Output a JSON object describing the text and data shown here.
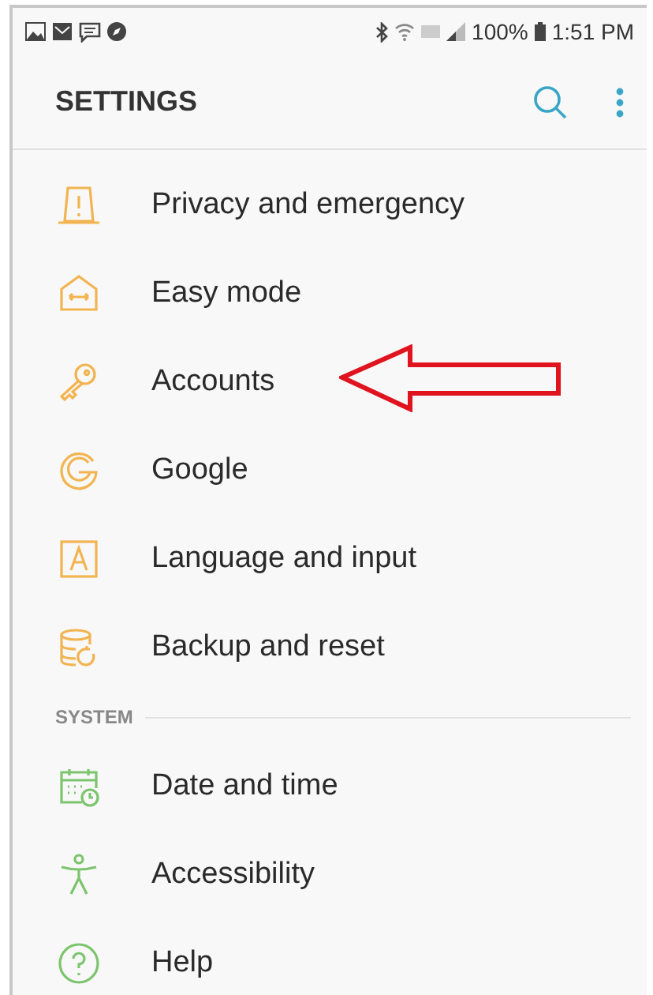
{
  "status_bar": {
    "battery": "100%",
    "time": "1:51 PM"
  },
  "header": {
    "title": "SETTINGS"
  },
  "sections": [
    {
      "items": [
        {
          "label": "Privacy and emergency"
        },
        {
          "label": "Easy mode"
        },
        {
          "label": "Accounts"
        },
        {
          "label": "Google"
        },
        {
          "label": "Language and input"
        },
        {
          "label": "Backup and reset"
        }
      ]
    },
    {
      "heading": "SYSTEM",
      "items": [
        {
          "label": "Date and time"
        },
        {
          "label": "Accessibility"
        },
        {
          "label": "Help"
        }
      ]
    }
  ]
}
